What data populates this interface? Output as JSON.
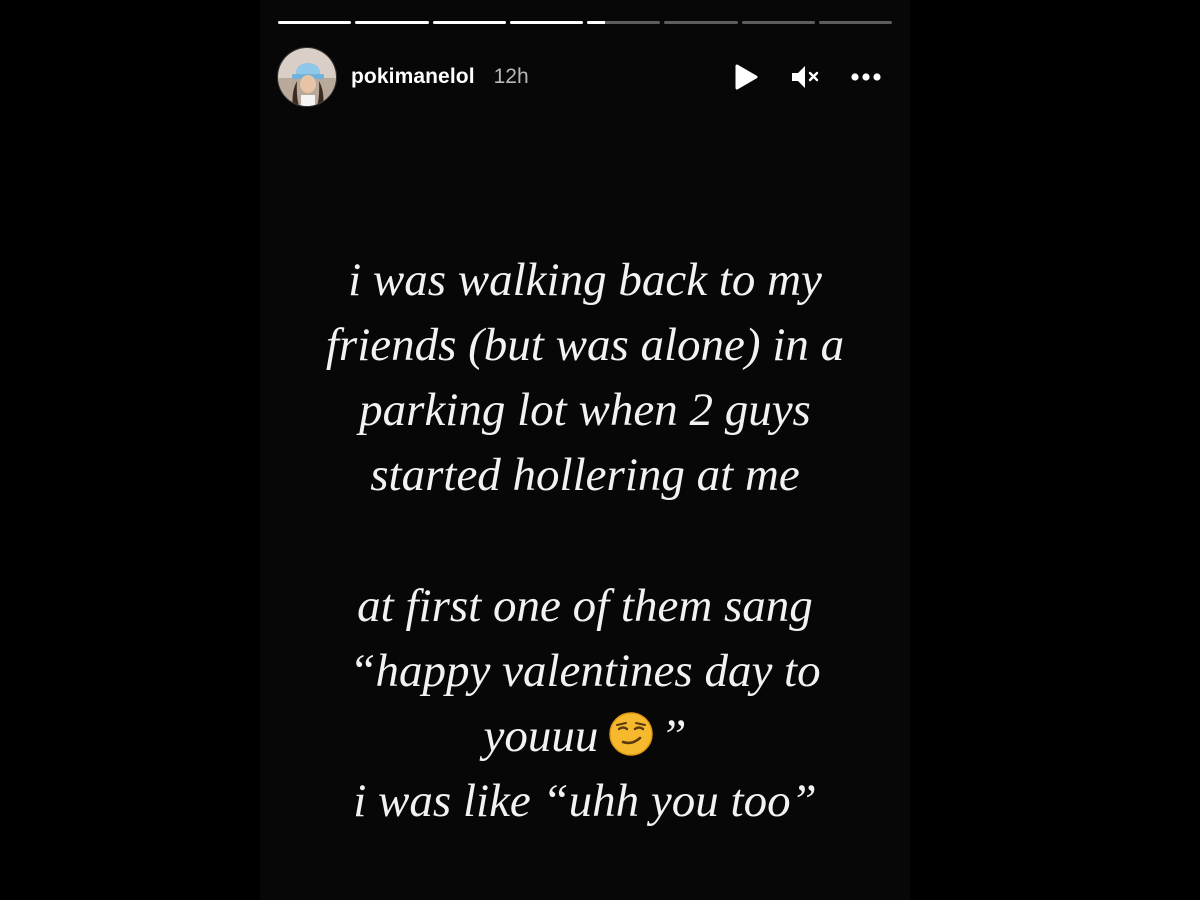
{
  "story": {
    "progress": {
      "segments": 8,
      "completed": 4,
      "current_fraction": 0.25
    },
    "header": {
      "username": "pokimanelol",
      "timestamp": "12h",
      "avatar_icon": "profile-photo-avatar",
      "controls": [
        {
          "name": "play-icon"
        },
        {
          "name": "muted-speaker-icon"
        },
        {
          "name": "more-options-icon"
        }
      ]
    },
    "text": {
      "paragraph_1": [
        "i was walking back to my",
        "friends (but was alone) in a",
        "parking lot when 2 guys",
        "started hollering at me"
      ],
      "paragraph_2": [
        "at first one of them sang",
        "“happy valentines day to",
        "youuu",
        "”",
        "i was like “uhh you too”"
      ],
      "emoji": "smirking-face-emoji"
    }
  },
  "colors": {
    "background": "#000000",
    "story_background": "#070707",
    "text": "#f2f2f2",
    "timestamp": "#b8b8b8",
    "emoji_fill": "#f6b92e"
  }
}
